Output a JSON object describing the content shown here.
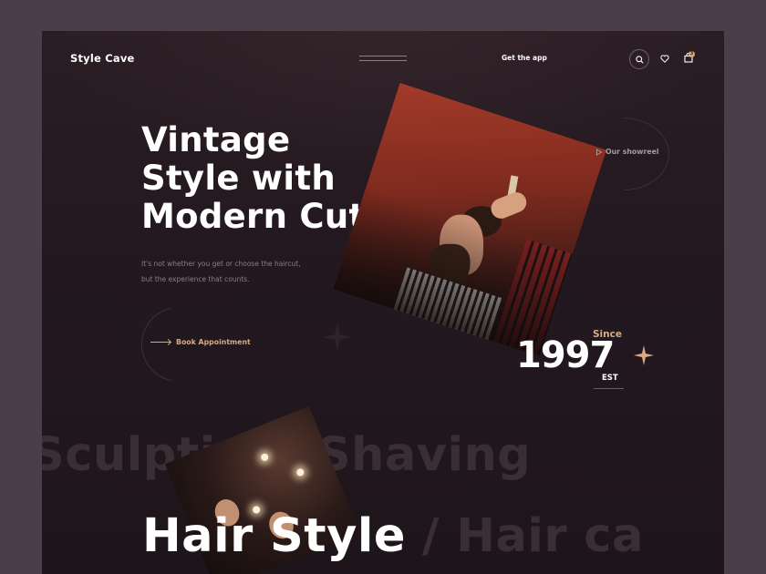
{
  "nav": {
    "logo": "Style Cave",
    "get_app": "Get the app",
    "cart_count": "3"
  },
  "hero": {
    "title_line1": "Vintage",
    "title_line2": "Style with",
    "title_line3": "Modern Cuts",
    "subtitle_line1": "It's not whether you get or choose the haircut,",
    "subtitle_line2": "but the experience that counts.",
    "book_label": "Book Appointment",
    "showreel_label": "Our showreel",
    "since_label": "Since",
    "year": "1997",
    "est_label": "EST"
  },
  "services": {
    "marquee_line1": "Sculpting /Shaving",
    "marquee_line2_highlight": "Hair Style",
    "marquee_line2_rest": "/ Hair ca"
  },
  "colors": {
    "accent": "#d6aa83",
    "background": "#231820",
    "outer": "#4a3f49"
  },
  "icons": [
    "search-icon",
    "heart-icon",
    "bag-icon",
    "play-icon",
    "arrow-right-icon",
    "star-icon"
  ]
}
